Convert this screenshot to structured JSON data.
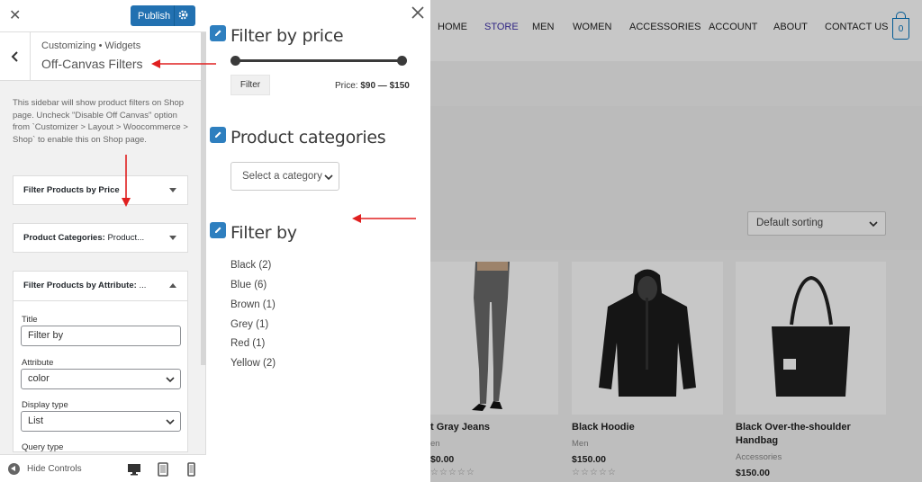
{
  "customizer": {
    "publish_label": "Publish",
    "crumb": "Customizing • Widgets",
    "section_title": "Off-Canvas Filters",
    "description": "This sidebar will show product filters on Shop page. Uncheck \"Disable Off Canvas\" option from `Customizer > Layout > Woocommerce > Shop` to enable this on Shop page.",
    "widgets": [
      {
        "title": "Filter Products by Price",
        "subtitle": ""
      },
      {
        "title": "Product Categories:",
        "subtitle": "Product..."
      },
      {
        "title": "Filter Products by Attribute:",
        "subtitle": "..."
      }
    ],
    "form": {
      "title_label": "Title",
      "title_value": "Filter by",
      "attribute_label": "Attribute",
      "attribute_value": "color",
      "display_label": "Display type",
      "display_value": "List",
      "query_label": "Query type"
    },
    "hide_controls": "Hide Controls"
  },
  "offcanvas": {
    "price_title": "Filter by price",
    "filter_button": "Filter",
    "price_prefix": "Price:",
    "price_range": "$90 — $150",
    "categories_title": "Product categories",
    "category_placeholder": "Select a category",
    "filter_by_title": "Filter by",
    "attributes": [
      "Black (2)",
      "Blue (6)",
      "Brown (1)",
      "Grey (1)",
      "Red (1)",
      "Yellow (2)"
    ]
  },
  "store": {
    "nav": [
      "HOME",
      "STORE",
      "MEN",
      "WOMEN",
      "ACCESSORIES",
      "ACCOUNT",
      "ABOUT",
      "CONTACT US"
    ],
    "active_nav": "STORE",
    "cart_count": "0",
    "sorting": "Default sorting",
    "products": [
      {
        "name": "t Gray Jeans",
        "category": "en",
        "price": "$0.00"
      },
      {
        "name": "Black Hoodie",
        "category": "Men",
        "price": "$150.00"
      },
      {
        "name": "Black Over-the-shoulder Handbag",
        "category": "Accessories",
        "price": "$150.00"
      }
    ],
    "stars": "☆☆☆☆☆",
    "colors": {
      "accent": "#0274be",
      "active_nav": "#3d2fa8",
      "publish": "#2271b1",
      "annotation": "#e02020"
    }
  }
}
